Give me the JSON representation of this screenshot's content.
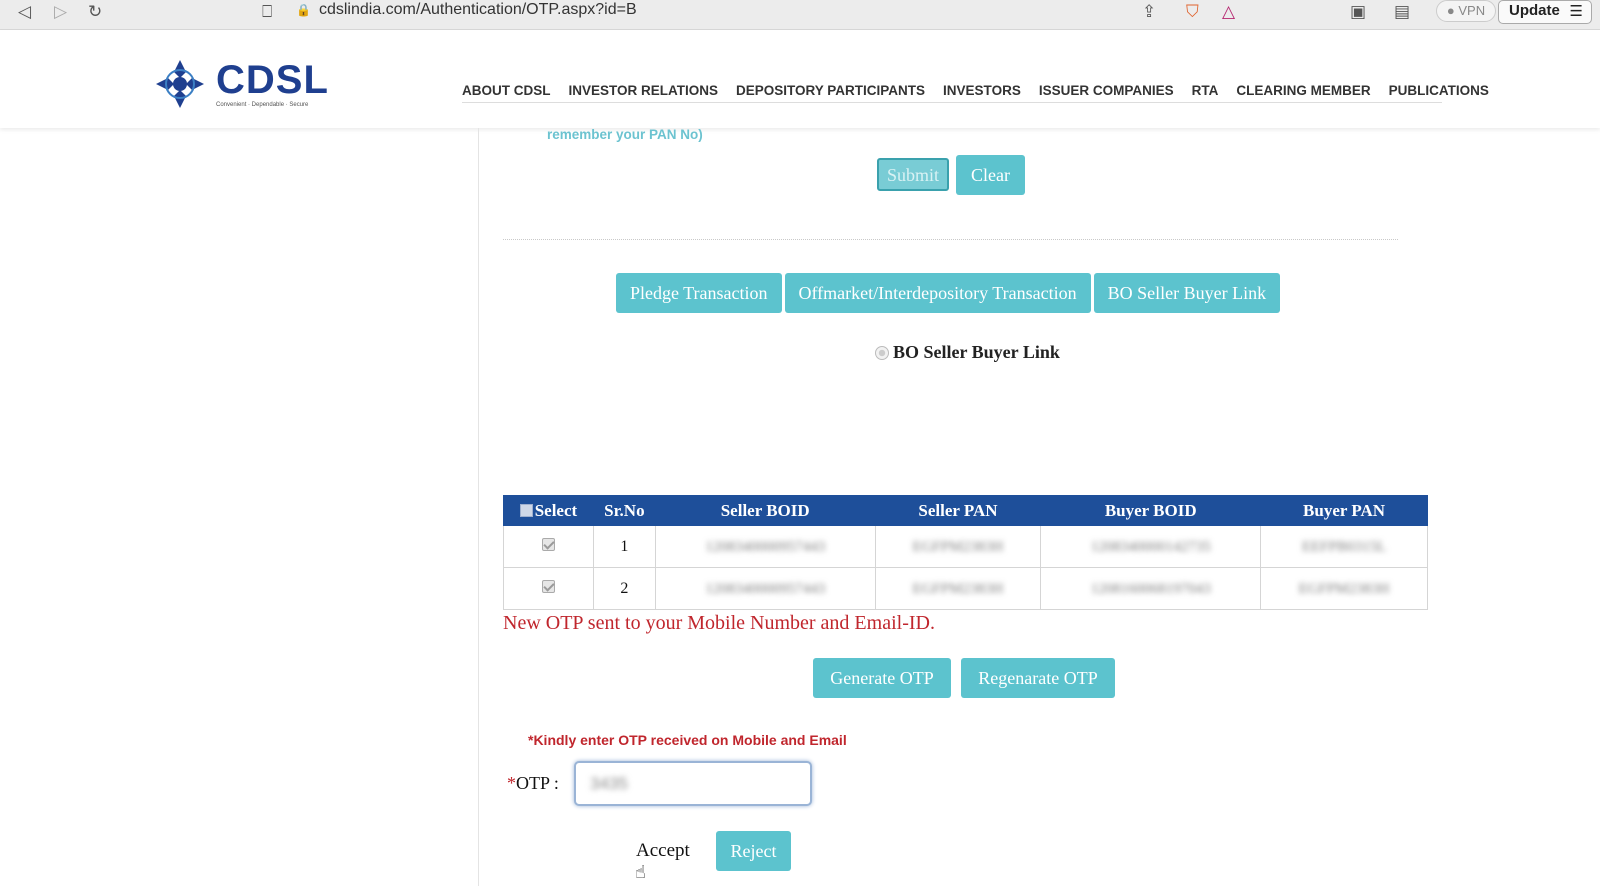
{
  "browser": {
    "url": "cdslindia.com/Authentication/OTP.aspx?id=B",
    "vpn": "VPN",
    "update": "Update"
  },
  "header": {
    "logo_text": "CDSL",
    "logo_tagline": "Convenient · Dependable · Secure",
    "nav": [
      "ABOUT CDSL",
      "INVESTOR RELATIONS",
      "DEPOSITORY PARTICIPANTS",
      "INVESTORS",
      "ISSUER COMPANIES",
      "RTA",
      "CLEARING MEMBER",
      "PUBLICATIONS"
    ]
  },
  "form": {
    "pan_note": "remember your PAN No)",
    "submit": "Submit",
    "clear": "Clear"
  },
  "tabs": [
    "Pledge Transaction",
    "Offmarket/Interdepository Transaction",
    "BO Seller Buyer Link"
  ],
  "radio_label": "BO Seller Buyer Link",
  "table": {
    "headers": [
      "Select",
      "Sr.No",
      "Seller BOID",
      "Seller PAN",
      "Buyer BOID",
      "Buyer PAN"
    ],
    "rows": [
      {
        "srno": "1",
        "seller_boid": "1208340000957443",
        "seller_pan": "EGFPM2383H",
        "buyer_boid": "1208340000142735",
        "buyer_pan": "EEFPB0315L"
      },
      {
        "srno": "2",
        "seller_boid": "1208340000957443",
        "seller_pan": "EGFPM2383H",
        "buyer_boid": "1208160068197043",
        "buyer_pan": "EGFPM2383H"
      }
    ]
  },
  "otp": {
    "message": "New OTP sent to your Mobile Number and Email-ID.",
    "generate": "Generate OTP",
    "regenerate": "Regenarate OTP",
    "hint": "*Kindly enter OTP received on Mobile and Email",
    "label_star": "*",
    "label": "OTP :",
    "value": "3435",
    "accept": "Accept",
    "reject": "Reject"
  }
}
